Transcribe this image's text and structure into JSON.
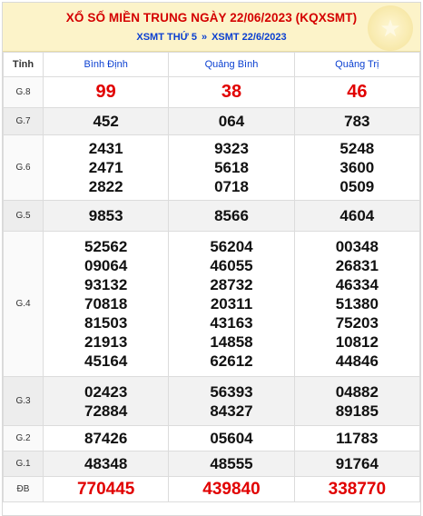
{
  "header": {
    "title": "XỔ SỐ MIỀN TRUNG NGÀY 22/06/2023 (KQXSMT)",
    "link_day": "XSMT THỨ 5",
    "separator": "»",
    "link_date": "XSMT 22/6/2023",
    "decor_icon": "star-icon"
  },
  "table": {
    "label_header": "Tỉnh",
    "provinces": [
      "Bình Định",
      "Quảng Bình",
      "Quảng Trị"
    ],
    "rows": [
      {
        "label": "G.8",
        "cells": [
          [
            "99"
          ],
          [
            "38"
          ],
          [
            "46"
          ]
        ]
      },
      {
        "label": "G.7",
        "cells": [
          [
            "452"
          ],
          [
            "064"
          ],
          [
            "783"
          ]
        ]
      },
      {
        "label": "G.6",
        "cells": [
          [
            "2431",
            "2471",
            "2822"
          ],
          [
            "9323",
            "5618",
            "0718"
          ],
          [
            "5248",
            "3600",
            "0509"
          ]
        ]
      },
      {
        "label": "G.5",
        "cells": [
          [
            "9853"
          ],
          [
            "8566"
          ],
          [
            "4604"
          ]
        ]
      },
      {
        "label": "G.4",
        "cells": [
          [
            "52562",
            "09064",
            "93132",
            "70818",
            "81503",
            "21913",
            "45164"
          ],
          [
            "56204",
            "46055",
            "28732",
            "20311",
            "43163",
            "14858",
            "62612"
          ],
          [
            "00348",
            "26831",
            "46334",
            "51380",
            "75203",
            "10812",
            "44846"
          ]
        ]
      },
      {
        "label": "G.3",
        "cells": [
          [
            "02423",
            "72884"
          ],
          [
            "56393",
            "84327"
          ],
          [
            "04882",
            "89185"
          ]
        ]
      },
      {
        "label": "G.2",
        "cells": [
          [
            "87426"
          ],
          [
            "05604"
          ],
          [
            "11783"
          ]
        ]
      },
      {
        "label": "G.1",
        "cells": [
          [
            "48348"
          ],
          [
            "48555"
          ],
          [
            "91764"
          ]
        ]
      },
      {
        "label": "ĐB",
        "cells": [
          [
            "770445"
          ],
          [
            "439840"
          ],
          [
            "338770"
          ]
        ]
      }
    ]
  },
  "colors": {
    "red": "#e10000",
    "blue": "#0a3fd1",
    "header_bg": "#fcf3c9"
  }
}
